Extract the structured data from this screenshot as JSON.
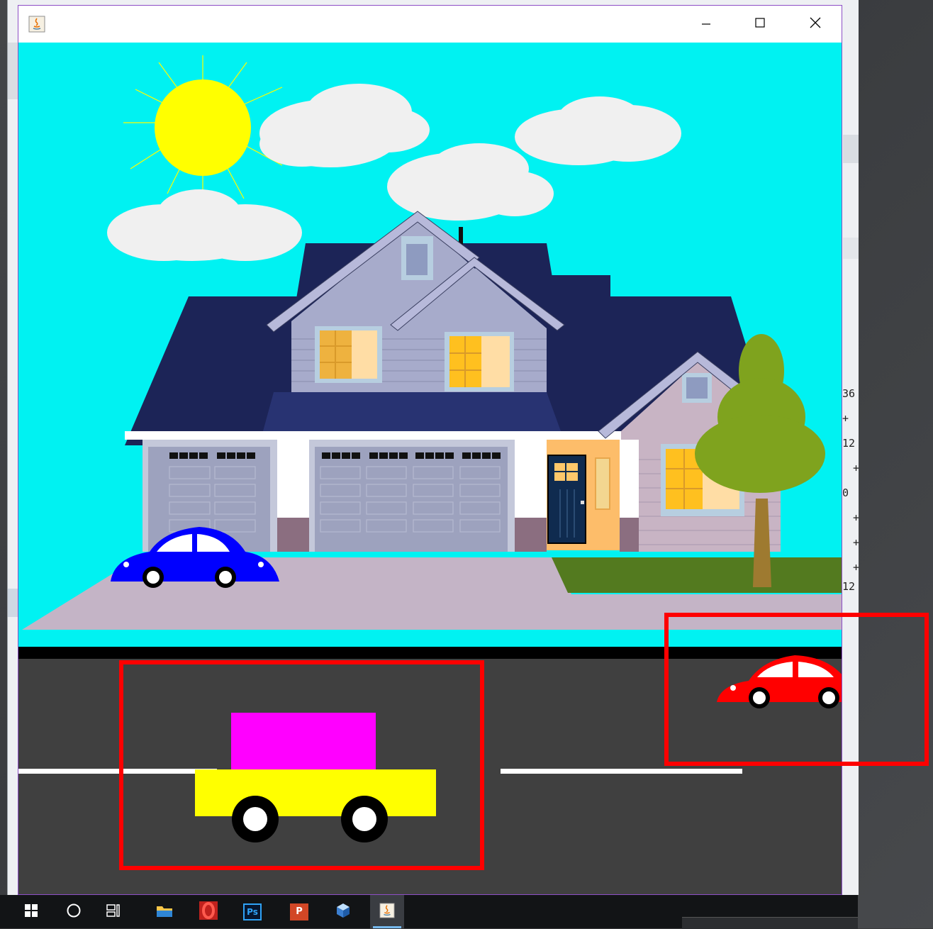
{
  "window": {
    "title": "",
    "controls": {
      "minimize_icon": "minimize-icon",
      "maximize_icon": "maximize-icon",
      "close_icon": "close-icon"
    }
  },
  "scene": {
    "sky_color": "#00F2F2",
    "sun_color": "#FFFF00",
    "cloud_color": "#F0F0F0",
    "house_roof_color": "#1C2457",
    "siding_color": "#A7ABCB",
    "garage_color": "#9DA2BE",
    "door_color": "#0F2B4F",
    "porch_color": "#FDBD6A",
    "driveway_color": "#C4B4C6",
    "lawn_color": "#537A1F",
    "tree_color": "#7FA31E",
    "trunk_color": "#9E7A30",
    "road_color": "#404040",
    "lane_marking_color": "#FFFFFF",
    "parked_car_color": "#0000FF",
    "moving_car_color": "#FF0000",
    "truck_cab_color": "#FF00FF",
    "truck_body_color": "#FFFF00",
    "highlight_box_color": "#FF0000"
  },
  "background_window": {
    "code_fragments": [
      "36",
      "+",
      "12",
      "+",
      "0",
      "+",
      "+",
      "+",
      "12"
    ]
  },
  "taskbar": {
    "items": [
      {
        "name": "start",
        "icon": "windows-icon"
      },
      {
        "name": "search",
        "icon": "cortana-circle-icon"
      },
      {
        "name": "task-view",
        "icon": "task-view-icon"
      },
      {
        "name": "file-explorer",
        "icon": "folder-icon"
      },
      {
        "name": "opera",
        "icon": "opera-icon"
      },
      {
        "name": "photoshop",
        "icon": "photoshop-icon",
        "label": "Ps"
      },
      {
        "name": "powerpoint",
        "icon": "powerpoint-icon",
        "label": "P"
      },
      {
        "name": "virtualbox",
        "icon": "cube-icon"
      },
      {
        "name": "java-app",
        "icon": "java-icon"
      }
    ],
    "photoshop_label": "Ps",
    "powerpoint_label": "P"
  }
}
